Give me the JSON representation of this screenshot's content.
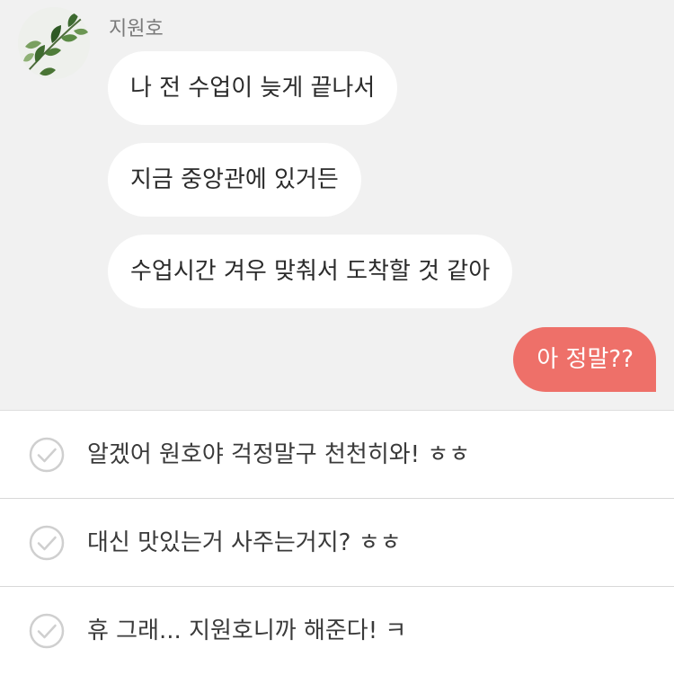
{
  "chat": {
    "sender_name": "지원호",
    "messages": [
      {
        "from": "other",
        "text": "나 전 수업이 늦게 끝나서"
      },
      {
        "from": "other",
        "text": "지금 중앙관에 있거든"
      },
      {
        "from": "other",
        "text": "수업시간 겨우 맞춰서 도착할 것 같아"
      },
      {
        "from": "me",
        "text": "아 정말??"
      }
    ]
  },
  "reply_options": [
    {
      "text": "알겠어 원호야 걱정말구 천천히와! ㅎㅎ",
      "icon": "check-circle-icon"
    },
    {
      "text": "대신 맛있는거 사주는거지? ㅎㅎ",
      "icon": "check-circle-icon"
    },
    {
      "text": "휴 그래... 지원호니까 해준다! ㅋ",
      "icon": "check-circle-icon"
    }
  ],
  "colors": {
    "chat_background": "#f1f1f1",
    "my_bubble": "#ee7069",
    "other_bubble": "#ffffff",
    "check_icon": "#cfcfcf"
  }
}
